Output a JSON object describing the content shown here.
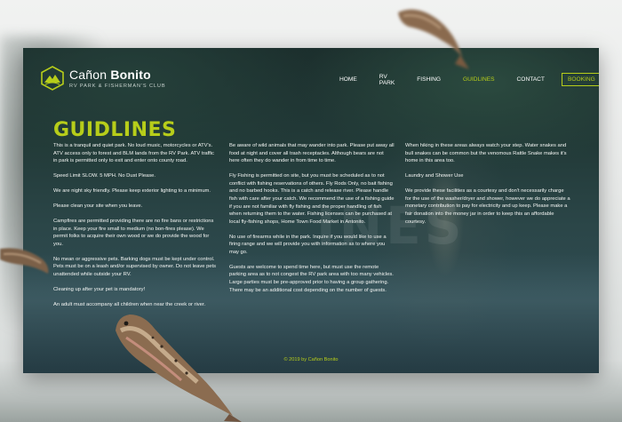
{
  "brand": {
    "name_light": "Cañon ",
    "name_bold": "Bonito",
    "tagline": "RV PARK & FISHERMAN'S CLUB"
  },
  "nav": {
    "items": [
      "HOME",
      "RV PARK",
      "FISHING",
      "GUIDLINES",
      "CONTACT"
    ],
    "active": "GUIDLINES",
    "booking": "BOOKING"
  },
  "page": {
    "title": "GUIDLINES",
    "watermark": "INES",
    "columns": [
      [
        "This is a tranquil and quiet park. No loud music, motorcycles or ATV's. ATV access only to forest and BLM lands from the RV Park. ATV traffic in park is permitted only to exit and enter onto county road.",
        "Speed Limit SLOW. 5 MPH. No Dust Please.",
        "We are night sky friendly. Please keep exterior lighting to a minimum.",
        "Please clean your site when you leave.",
        "Campfires are permitted providing there are no fire bans or restrictions in place. Keep your fire small to medium (no bon-fires please). We permit folks to acquire their own wood or we do provide the wood for you.",
        "No mean or aggressive pets. Barking dogs must be kept under control. Pets must be on a leash and/or supervised by owner. Do not leave pets unattended while outside your RV.",
        "Cleaning up after your pet is mandatory!",
        "An adult must accompany all children when near the creek or river."
      ],
      [
        "Be aware of wild animals that may wander into park. Please put away all food at night and cover all trash receptacles. Although bears are not here often they do wander in from time to time.",
        "Fly Fishing is permitted on site, but you must be scheduled as to not conflict with fishing reservations of others. Fly Rods Only, no bait fishing and no barbed hooks. This is a catch and release river. Please handle fish with care after your catch. We recommend the use of a fishing guide if you are not familiar with fly fishing and the proper handling of fish when returning them to the water. Fishing licenses can be purchased at local fly-fishing shops, Home Town Food Market in Antonito.",
        "No use of firearms while in the park. Inquire if you would like to use a firing range and we will provide you with information as to where you may go.",
        "Guests are welcome to spend time here, but must use the remote parking area as to not congest the RV park area with too many vehicles. Large parties must be pre-approved prior to having a group gathering. There may be an additional cost depending on the number of guests."
      ],
      [
        "When hiking in these areas always watch your step. Water snakes and bull snakes can be common but the venomous Rattle Snake makes it's home in this area too.",
        "Laundry and Shower Use",
        "We provide these facilities as a courtesy and don't necessarily charge for the use of the washer/dryer and shower, however we do appreciate a monetary contribution to pay for electricity and up keep. Please make a fair donation into the money jar in order to keep this an affordable courtesy."
      ]
    ],
    "footer": "© 2019 by Cañon Bonito"
  },
  "colors": {
    "accent": "#b7cd1a",
    "text": "#f4f6f4",
    "frame_dark": "#1c2f2d"
  },
  "icons": {
    "logo": "mountain-hexagon-logo-icon",
    "fish": "leaping-trout-icon"
  }
}
